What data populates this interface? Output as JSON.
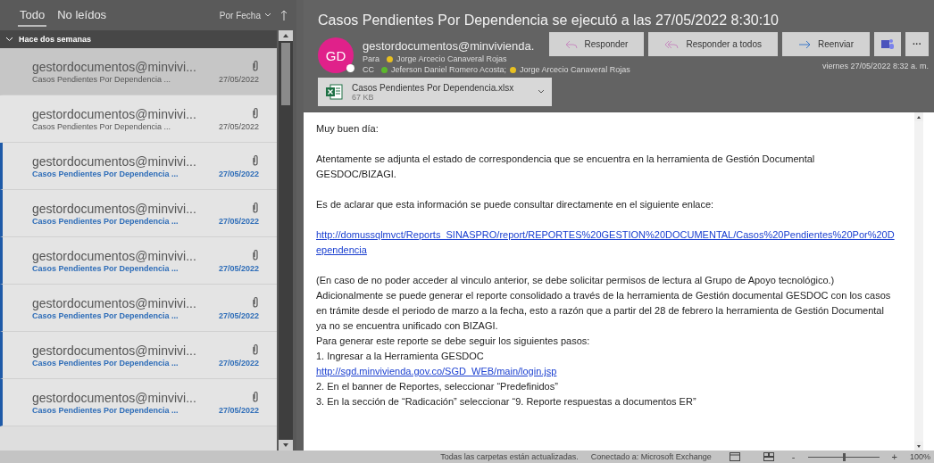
{
  "list_header": {
    "filters": [
      {
        "label": "Todo",
        "selected": true
      },
      {
        "label": "No leídos",
        "selected": false
      }
    ],
    "sort": "Por Fecha"
  },
  "group": {
    "label": "Hace dos semanas",
    "expanded": true
  },
  "messages": [
    {
      "sender": "gestordocumentos@minvivi...",
      "subject": "Casos Pendientes Por Dependencia ...",
      "date": "27/05/2022",
      "selected": true,
      "unread": false
    },
    {
      "sender": "gestordocumentos@minvivi...",
      "subject": "Casos Pendientes Por Dependencia ...",
      "date": "27/05/2022",
      "selected": false,
      "unread": false
    },
    {
      "sender": "gestordocumentos@minvivi...",
      "subject": "Casos Pendientes Por Dependencia ...",
      "date": "27/05/2022",
      "selected": false,
      "unread": true
    },
    {
      "sender": "gestordocumentos@minvivi...",
      "subject": "Casos Pendientes Por Dependencia ...",
      "date": "27/05/2022",
      "selected": false,
      "unread": true
    },
    {
      "sender": "gestordocumentos@minvivi...",
      "subject": "Casos Pendientes Por Dependencia ...",
      "date": "27/05/2022",
      "selected": false,
      "unread": true
    },
    {
      "sender": "gestordocumentos@minvivi...",
      "subject": "Casos Pendientes Por Dependencia ...",
      "date": "27/05/2022",
      "selected": false,
      "unread": true
    },
    {
      "sender": "gestordocumentos@minvivi...",
      "subject": "Casos Pendientes Por Dependencia ...",
      "date": "27/05/2022",
      "selected": false,
      "unread": true
    },
    {
      "sender": "gestordocumentos@minvivi...",
      "subject": "Casos Pendientes Por Dependencia ...",
      "date": "27/05/2022",
      "selected": false,
      "unread": true
    }
  ],
  "reading": {
    "subject": "Casos Pendientes Por Dependencia se ejecutó a las 27/05/2022 8:30:10",
    "avatar": "GD",
    "sender": "gestordocumentos@minvivienda.",
    "to_label": "Para",
    "to": [
      {
        "name": "Jorge Arcecio Canaveral Rojas",
        "color": "#e8c020"
      }
    ],
    "cc_label": "CC",
    "cc": [
      {
        "name": "Jeferson Daniel Romero Acosta;",
        "color": "#5cb82c"
      },
      {
        "name": "Jorge Arcecio Canaveral Rojas",
        "color": "#e8c020"
      }
    ],
    "actions": [
      {
        "kind": "reply",
        "label": "Responder"
      },
      {
        "kind": "reply_all",
        "label": "Responder a todos"
      },
      {
        "kind": "forward",
        "label": "Reenviar"
      },
      {
        "kind": "teams"
      },
      {
        "kind": "more",
        "label": "···"
      }
    ],
    "date": "viernes 27/05/2022 8:32 a. m.",
    "attachment": {
      "name": "Casos Pendientes Por Dependencia.xlsx",
      "size": "67 KB"
    },
    "body": [
      [
        {
          "kind": "text",
          "text": "Muy buen día:"
        }
      ],
      [
        {
          "kind": "text",
          "text": "Atentamente se adjunta el estado de correspondencia que se encuentra en la herramienta de Gestión Documental GESDOC/BIZAGI."
        }
      ],
      [
        {
          "kind": "text",
          "text": "Es de aclarar que esta información se puede consultar directamente en el siguiente enlace:"
        }
      ],
      [
        {
          "kind": "link",
          "text": "http://domussqlmvct/Reports_SINASPRO/report/REPORTES%20GESTION%20DOCUMENTAL/Casos%20Pendientes%20Por%20Dependencia"
        }
      ],
      [
        {
          "kind": "text",
          "text": "(En caso de no poder acceder al vinculo anterior, se debe solicitar permisos de lectura al Grupo de Apoyo tecnológico.)"
        },
        {
          "kind": "text",
          "text": "Adicionalmente se puede generar el reporte consolidado a través de la herramienta de Gestión documental GESDOC con los casos en trámite desde el periodo de marzo a la fecha, esto a razón que a partir del 28 de febrero la herramienta de Gestión Documental ya no se encuentra unificado con BIZAGI."
        },
        {
          "kind": "text",
          "text": "Para generar este reporte se debe seguir los siguientes pasos:"
        },
        {
          "kind": "text",
          "text": "1. Ingresar a la Herramienta GESDOC"
        },
        {
          "kind": "link",
          "text": "http://sgd.minvivienda.gov.co/SGD_WEB/main/login.jsp"
        },
        {
          "kind": "text",
          "text": "2. En el banner de Reportes, seleccionar “Predefinidos”"
        },
        {
          "kind": "text",
          "text": "3. En la sección de “Radicación” seleccionar “9. Reporte respuestas a documentos ER”"
        }
      ]
    ]
  },
  "status_bar": {
    "sync": "Todas las carpetas están actualizadas.",
    "connection": "Conectado a: Microsoft Exchange",
    "zoom_out": "-",
    "zoom": {
      "level": 0.5
    },
    "zoom_in": "+",
    "zoom_percent": "100%"
  }
}
